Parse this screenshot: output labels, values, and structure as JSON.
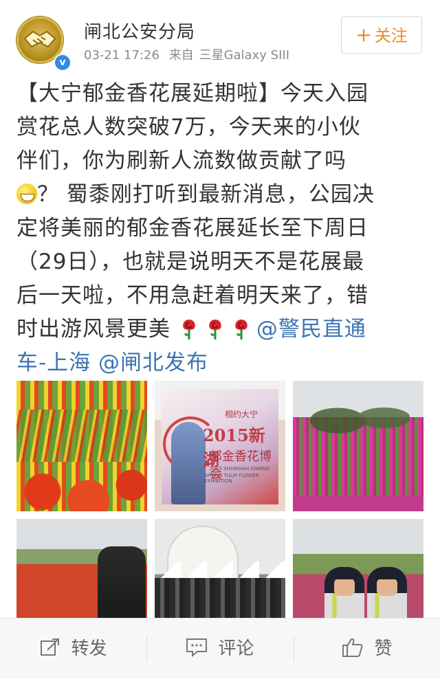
{
  "post": {
    "user": {
      "name": "闸北公安分局"
    },
    "meta": {
      "time": "03-21 17:26",
      "source_prefix": "来自",
      "source": "三星Galaxy SIII"
    },
    "follow": {
      "plus": "+",
      "label": "关注"
    },
    "text": {
      "line1": "【大宁郁金香花展延期啦】今天入园",
      "line2": "赏花总人数突破7万，今天来的小伙",
      "line3": "伴们，你为刷新人流数做贡献了吗",
      "line4_after_emoji": "？ 蜀黍刚打听到最新消息，公园决",
      "line5": "定将美丽的郁金香花展延长至下周日",
      "line6": "（29日），也就是说明天不是花展最",
      "line7": "后一天啦，不用急赶着明天来了，错",
      "line8": "时出游风景更美",
      "mention1_part1": "@警民直通",
      "mention1_part2": "车-上海",
      "mention2": "@闸北发布"
    },
    "poster": {
      "top": "相约大宁",
      "title": "2015新湖",
      "subtitle": "郁金香花博会",
      "line_a": "2015 SHANGHAI DANING",
      "line_b": "SPRING TULIP FLOWER EXHIBITION"
    }
  },
  "actions": {
    "repost": "转发",
    "comment": "评论",
    "like": "赞"
  },
  "colors": {
    "link": "#3c74b2",
    "follow_accent": "#f08a21",
    "verify_badge": "#2f8be6"
  },
  "icons": [
    "verified-icon",
    "smile-emoji-icon",
    "rose-icon",
    "repost-icon",
    "comment-icon",
    "like-icon"
  ]
}
